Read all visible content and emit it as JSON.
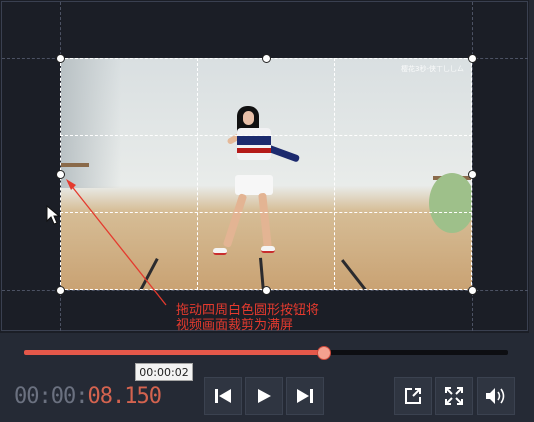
{
  "video": {
    "watermark": "樱花3秒-侠ㄒ乚乚ㄙ"
  },
  "annotation": {
    "line1": "拖动四周白色圆形按钮将",
    "line2": "视频画面裁剪为满屏",
    "color": "#e43a2e"
  },
  "player": {
    "progress_fraction": 0.62,
    "tooltip_time": "00:00:02",
    "timecode_dim": "00:00:",
    "timecode_live": "08.150",
    "accent": "#e5584a"
  },
  "icons": {
    "prev": "skip-previous-icon",
    "play": "play-icon",
    "next": "skip-next-icon",
    "export": "export-icon",
    "fullscreen": "fullscreen-icon",
    "volume": "volume-icon"
  }
}
